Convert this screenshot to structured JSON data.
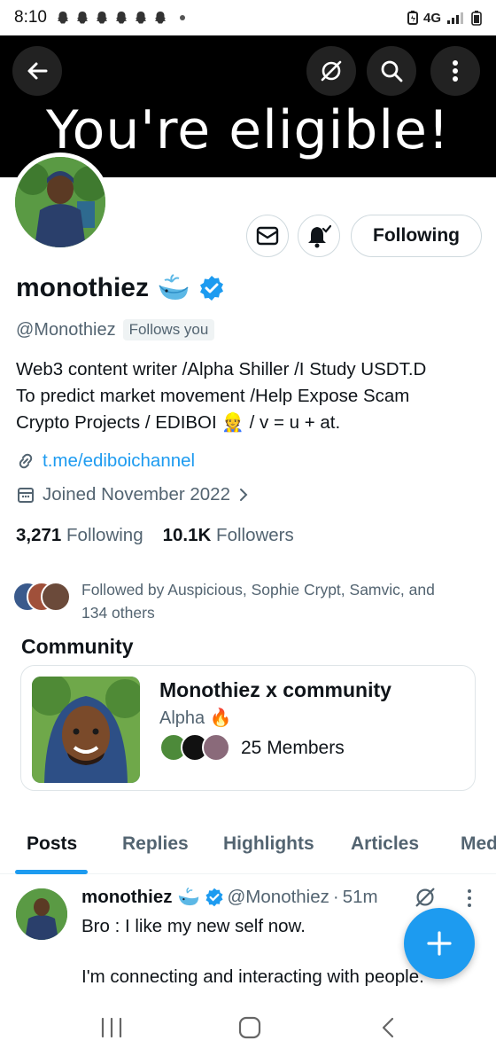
{
  "status_bar": {
    "time": "8:10",
    "network": "4G"
  },
  "banner": {
    "text": "You're eligible!"
  },
  "actions": {
    "following_label": "Following"
  },
  "profile": {
    "display_name": "monothiez",
    "handle": "@Monothiez",
    "follows_you": "Follows you",
    "bio_lines": [
      "Web3 content writer /Alpha Shiller /I Study USDT.D",
      "To predict market movement /Help Expose Scam",
      "Crypto Projects / EDIBOI 👷 /  v = u + at."
    ],
    "link": "t.me/ediboichannel",
    "joined": "Joined November 2022",
    "following_count": "3,271",
    "following_label": "Following",
    "followers_count": "10.1K",
    "followers_label": "Followers",
    "followed_by_line1": "Followed by Auspicious, Sophie Crypt, Samvic, and",
    "followed_by_line2": "134 others"
  },
  "community": {
    "heading": "Community",
    "name": "Monothiez x community",
    "tag": "Alpha 🔥",
    "members": "25 Members"
  },
  "tabs": [
    "Posts",
    "Replies",
    "Highlights",
    "Articles",
    "Media"
  ],
  "post": {
    "name": "monothiez",
    "handle": "@Monothiez",
    "sep": "·",
    "time": "51m",
    "line1": "Bro : I like my new self now.",
    "line2": "I'm connecting and interacting with people."
  },
  "colors": {
    "accent": "#1d9bf0",
    "text_primary": "#0f1419",
    "text_secondary": "#536471",
    "banner_bg": "#000000"
  }
}
